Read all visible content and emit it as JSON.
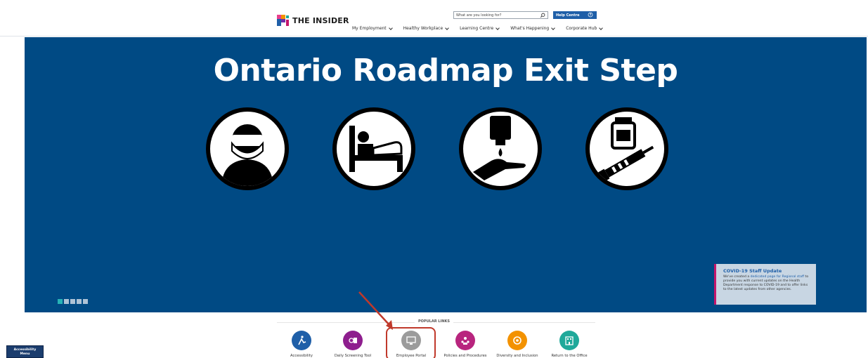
{
  "header": {
    "logo_text": "THE INSIDER",
    "search": {
      "placeholder": "What are you looking for?"
    },
    "help_label": "Help Centre",
    "nav": [
      {
        "label": "My Employment"
      },
      {
        "label": "Healthy Workplace"
      },
      {
        "label": "Learning Centre"
      },
      {
        "label": "What's Happening"
      },
      {
        "label": "Corporate Hub"
      }
    ]
  },
  "banner": {
    "title": "Ontario Roadmap Exit Step",
    "icons": [
      "face-mask-icon",
      "hospital-bed-icon",
      "hand-sanitizer-icon",
      "vaccine-icon"
    ],
    "background_color": "#004a84",
    "carousel": {
      "slide_count": 5,
      "active_index": 0
    }
  },
  "covid_card": {
    "title": "COVID-19 Staff Update",
    "body_prefix": "We've created a ",
    "link_text": "dedicated page for Regional staff",
    "body_suffix": " to provide you with current updates on the Health Department response to COVID-19 and to offer links to the latest updates from other agencies."
  },
  "popular_links": {
    "heading": "POPULAR LINKS",
    "items": [
      {
        "label": "Accessibility",
        "icon": "accessibility-icon",
        "color": "#1f5fa8"
      },
      {
        "label": "Daily Screening Tool",
        "icon": "screening-icon",
        "color": "#8e1e8e"
      },
      {
        "label": "Employee Portal",
        "icon": "portal-icon",
        "color": "#9b9b9b"
      },
      {
        "label": "Policies and Procedures",
        "icon": "policies-icon",
        "color": "#b8257e"
      },
      {
        "label": "Diversity and Inclusion",
        "icon": "diversity-icon",
        "color": "#f39200"
      },
      {
        "label": "Return to the Office",
        "icon": "office-icon",
        "color": "#1fa99a"
      }
    ]
  },
  "accessibility_menu": {
    "label_line1": "Accessibility",
    "label_line2": "Menu"
  }
}
